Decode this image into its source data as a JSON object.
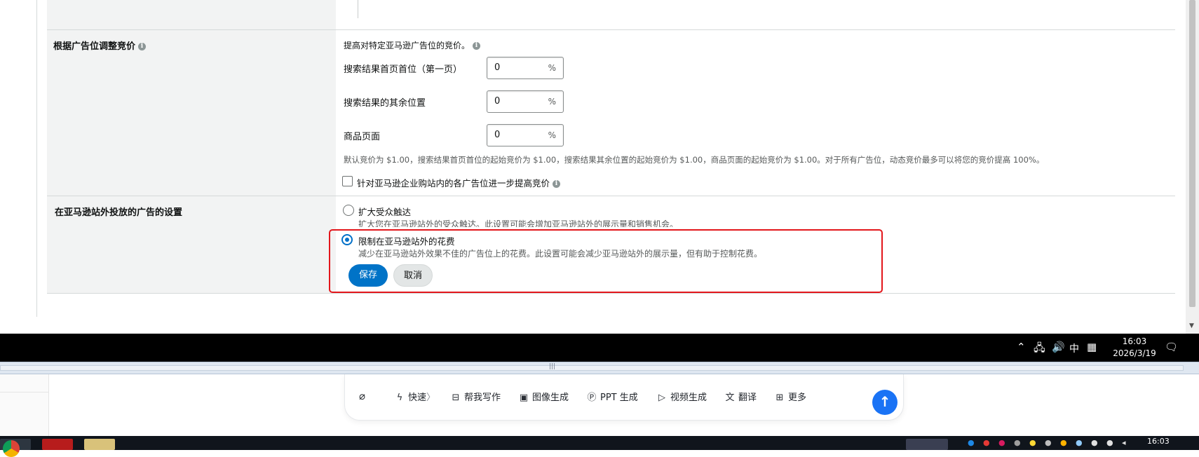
{
  "placement_section": {
    "label": "根据广告位调整竞价",
    "intro": "提高对特定亚马逊广告位的竞价。",
    "rows": [
      {
        "label": "搜索结果首页首位（第一页）",
        "value": "0",
        "unit": "%"
      },
      {
        "label": "搜索结果的其余位置",
        "value": "0",
        "unit": "%"
      },
      {
        "label": "商品页面",
        "value": "0",
        "unit": "%"
      }
    ],
    "note": "默认竞价为 $1.00，搜索结果首页首位的起始竞价为 $1.00，搜索结果其余位置的起始竞价为 $1.00，商品页面的起始竞价为 $1.00。对于所有广告位，动态竞价最多可以将您的竞价提高 100%。",
    "business_checkbox_label": "针对亚马逊企业购站内的各广告位进一步提高竞价",
    "business_checkbox_checked": false
  },
  "offsite_section": {
    "label": "在亚马逊站外投放的广告的设置",
    "options": [
      {
        "title": "扩大受众触达",
        "desc": "扩大您在亚马逊站外的受众触达。此设置可能会增加亚马逊站外的展示量和销售机会。",
        "selected": false
      },
      {
        "title": "限制在亚马逊站外的花费",
        "desc": "减少在亚马逊站外效果不佳的广告位上的花费。此设置可能会减少亚马逊站外的展示量，但有助于控制花费。",
        "selected": true
      }
    ],
    "save_label": "保存",
    "cancel_label": "取消"
  },
  "remote_taskbar": {
    "time": "16:03",
    "date": "2026/3/19",
    "ime": "中"
  },
  "composer": {
    "tools": [
      {
        "icon": "lightning-icon",
        "label": "快速"
      },
      {
        "icon": "write-icon",
        "label": "帮我写作"
      },
      {
        "icon": "image-icon",
        "label": "图像生成"
      },
      {
        "icon": "ppt-icon",
        "label": "PPT 生成"
      },
      {
        "icon": "video-icon",
        "label": "视频生成"
      },
      {
        "icon": "translate-icon",
        "label": "翻译"
      },
      {
        "icon": "grid-icon",
        "label": "更多"
      }
    ],
    "quick_suffix": "〉"
  },
  "host_taskbar": {
    "time": "16:03"
  },
  "colors": {
    "primary_blue": "#0073c7",
    "highlight_red": "#e3161b",
    "send_blue": "#1a73f5"
  }
}
